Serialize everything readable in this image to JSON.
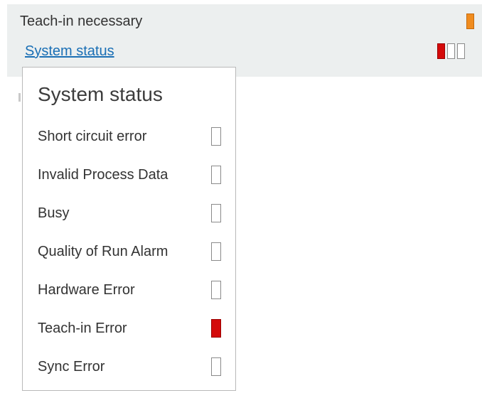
{
  "panel": {
    "teach_label": "Teach-in necessary",
    "teach_state": "on",
    "teach_color": "#f08c1f",
    "system_status_link": "System status",
    "system_status_leds": [
      {
        "state": "on",
        "color": "#d40a0a"
      },
      {
        "state": "off"
      },
      {
        "state": "off"
      }
    ]
  },
  "popup": {
    "title": "System status",
    "items": [
      {
        "label": "Short circuit error",
        "state": "off"
      },
      {
        "label": "Invalid Process Data",
        "state": "off"
      },
      {
        "label": "Busy",
        "state": "off"
      },
      {
        "label": "Quality of Run Alarm",
        "state": "off"
      },
      {
        "label": "Hardware Error",
        "state": "off"
      },
      {
        "label": "Teach-in Error",
        "state": "on",
        "color": "#d40a0a"
      },
      {
        "label": "Sync Error",
        "state": "off"
      }
    ]
  }
}
